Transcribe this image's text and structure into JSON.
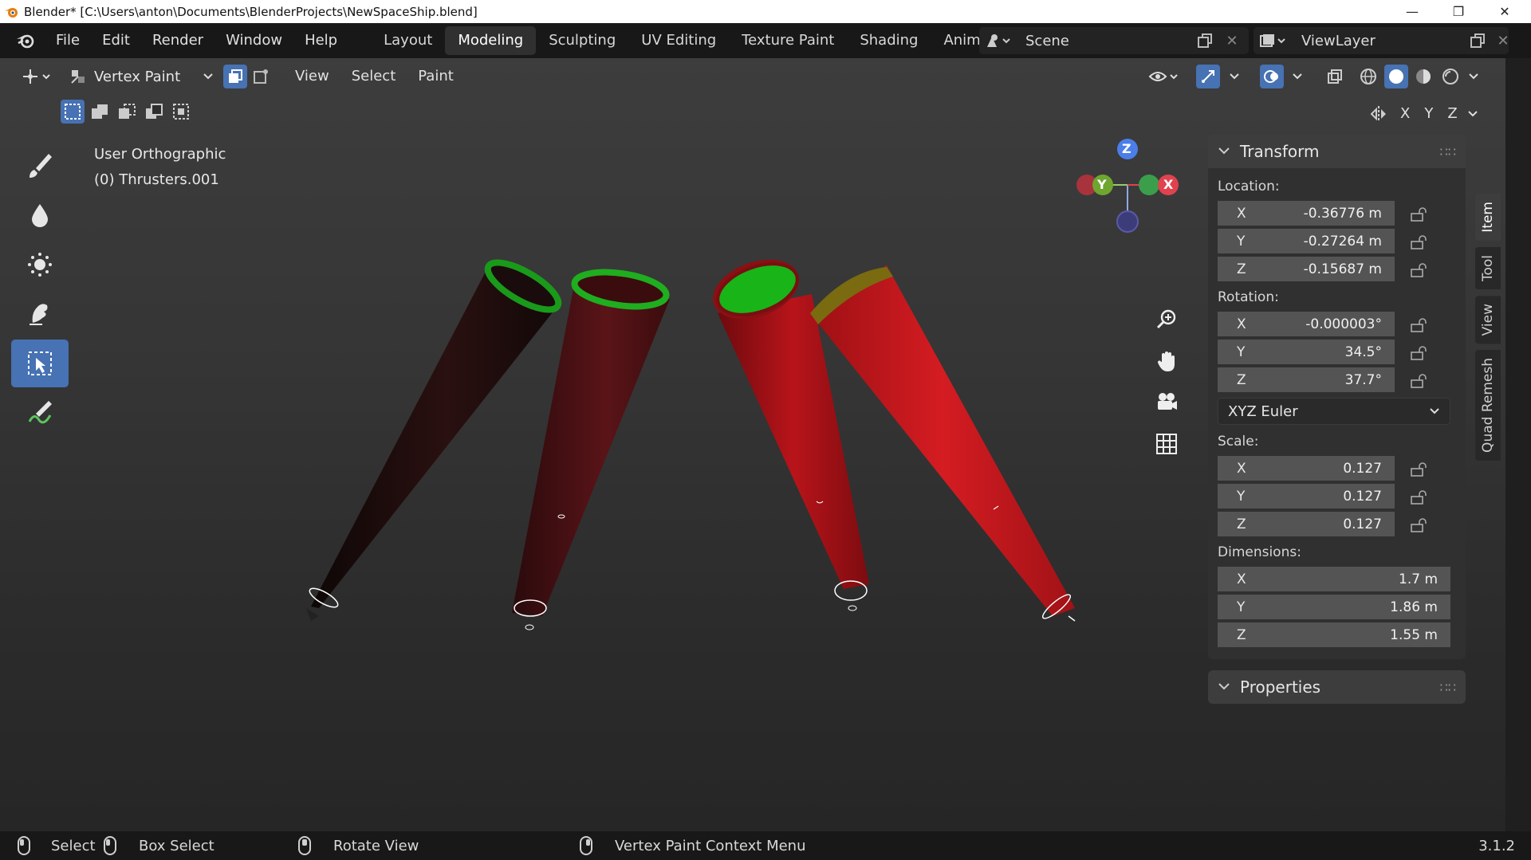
{
  "window": {
    "title": "Blender* [C:\\Users\\anton\\Documents\\BlenderProjects\\NewSpaceShip.blend]",
    "minimize": "—",
    "maximize": "❐",
    "close": "✕"
  },
  "menu": [
    "File",
    "Edit",
    "Render",
    "Window",
    "Help"
  ],
  "workspaces": [
    "Layout",
    "Modeling",
    "Sculpting",
    "UV Editing",
    "Texture Paint",
    "Shading",
    "Animatio"
  ],
  "active_workspace": "Modeling",
  "scene": {
    "label": "Scene"
  },
  "view_layer": {
    "label": "ViewLayer"
  },
  "viewport_header": {
    "mode": "Vertex Paint",
    "menus": [
      "View",
      "Select",
      "Paint"
    ],
    "axes": [
      "X",
      "Y",
      "Z"
    ]
  },
  "viewport": {
    "view_name": "User Orthographic",
    "object_info": "(0) Thrusters.001"
  },
  "gizmo": {
    "z": "Z",
    "y": "Y",
    "x": "X"
  },
  "tools": [
    "draw-brush-icon",
    "blur-icon",
    "average-icon",
    "smear-icon",
    "box-select-icon",
    "annotate-icon"
  ],
  "active_tool": "box-select-icon",
  "transform": {
    "title": "Transform",
    "location_label": "Location:",
    "location": [
      {
        "axis": "X",
        "value": "-0.36776 m"
      },
      {
        "axis": "Y",
        "value": "-0.27264 m"
      },
      {
        "axis": "Z",
        "value": "-0.15687 m"
      }
    ],
    "rotation_label": "Rotation:",
    "rotation": [
      {
        "axis": "X",
        "value": "-0.000003°"
      },
      {
        "axis": "Y",
        "value": "34.5°"
      },
      {
        "axis": "Z",
        "value": "37.7°"
      }
    ],
    "rotation_mode": "XYZ Euler",
    "scale_label": "Scale:",
    "scale": [
      {
        "axis": "X",
        "value": "0.127"
      },
      {
        "axis": "Y",
        "value": "0.127"
      },
      {
        "axis": "Z",
        "value": "0.127"
      }
    ],
    "dimensions_label": "Dimensions:",
    "dimensions": [
      {
        "axis": "X",
        "value": "1.7 m"
      },
      {
        "axis": "Y",
        "value": "1.86 m"
      },
      {
        "axis": "Z",
        "value": "1.55 m"
      }
    ]
  },
  "properties_panel": {
    "title": "Properties"
  },
  "side_tabs": [
    "Item",
    "Tool",
    "View",
    "Quad Remesh"
  ],
  "statusbar": {
    "select": "Select",
    "box_select": "Box Select",
    "rotate_view": "Rotate View",
    "context_menu": "Vertex Paint Context Menu",
    "version": "3.1.2"
  },
  "colors": {
    "accent": "#4772b3",
    "gizmo_x": "#e0424f",
    "gizmo_y": "#6ea630",
    "gizmo_z": "#4b7ee8"
  }
}
